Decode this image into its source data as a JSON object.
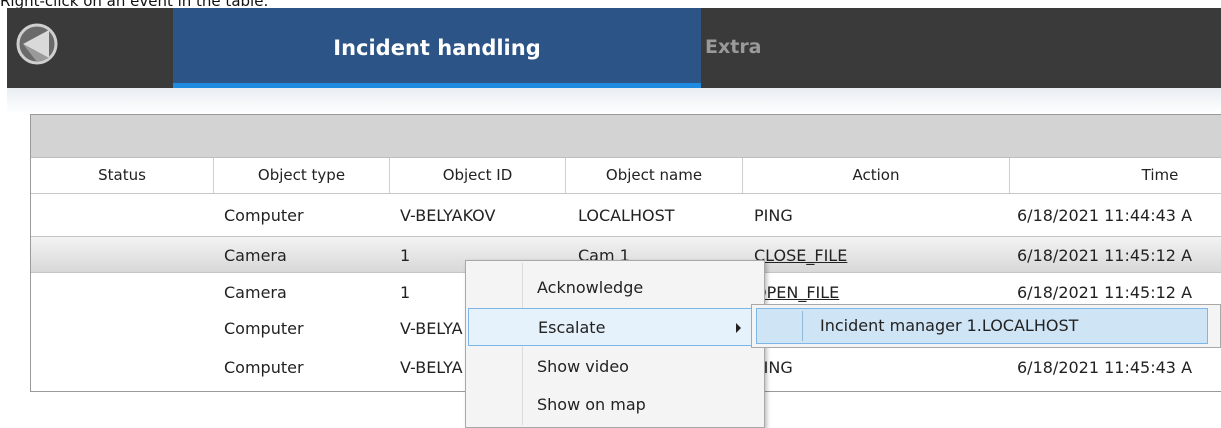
{
  "caption": "Right-click on an event in the table:",
  "topbar": {
    "tabs": [
      {
        "label": "Incident handling",
        "active": true
      },
      {
        "label": "Extra",
        "active": false
      }
    ]
  },
  "table": {
    "columns": [
      "Status",
      "Object type",
      "Object ID",
      "Object name",
      "Action",
      "Time"
    ],
    "rows": [
      {
        "status": "",
        "object_type": "Computer",
        "object_id": "V-BELYAKOV",
        "object_name": "LOCALHOST",
        "action": "PING",
        "time": "6/18/2021 11:44:43 A"
      },
      {
        "status": "",
        "object_type": "Camera",
        "object_id": "1",
        "object_name": "Cam 1",
        "action": "CLOSE_FILE",
        "time": "6/18/2021 11:45:12 A",
        "selected": true
      },
      {
        "status": "",
        "object_type": "Camera",
        "object_id": "1",
        "object_name": "",
        "action": "OPEN_FILE",
        "time": "6/18/2021 11:45:12 A"
      },
      {
        "status": "",
        "object_type": "Computer",
        "object_id": "V-BELYA",
        "object_name": "",
        "action": "",
        "time": ""
      },
      {
        "status": "",
        "object_type": "Computer",
        "object_id": "V-BELYA",
        "object_name": "",
        "action": "PING",
        "time": "6/18/2021 11:45:43 A"
      }
    ]
  },
  "context_menu": {
    "items": [
      {
        "label": "Acknowledge"
      },
      {
        "label": "Escalate",
        "has_submenu": true
      },
      {
        "label": "Show video"
      },
      {
        "label": "Show on map"
      }
    ],
    "submenu": {
      "items": [
        {
          "label": "Incident manager 1.LOCALHOST"
        }
      ]
    }
  },
  "colors": {
    "topbar": "#3a3a3a",
    "active_tab": "#2c5486",
    "tab_underline": "#1e8be0",
    "menu_highlight": "#cfe4f5"
  }
}
